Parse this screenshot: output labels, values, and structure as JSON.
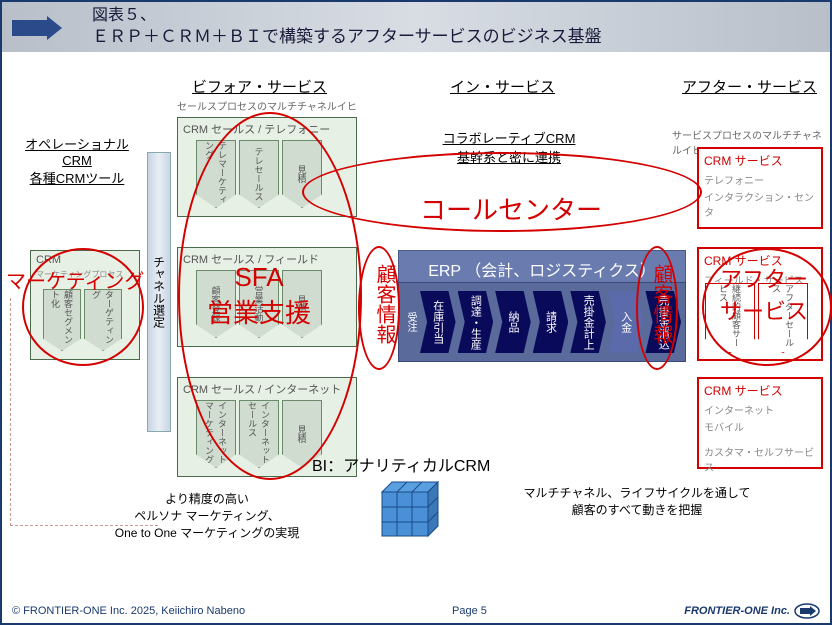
{
  "title": {
    "line1": "図表５、",
    "line2": "ＥＲＰ＋ＣＲＭ＋ＢＩで構築するアフターサービスのビジネス基盤"
  },
  "columns": {
    "before": "ビフォア・サービス",
    "before_sub": "セールスプロセスのマルチチャネルイヒ",
    "in": "イン・サービス",
    "after": "アフター・サービス",
    "after_sub": "サービスプロセスのマルチチャネルイヒ"
  },
  "left_label": {
    "l1": "オペレーショナルCRM",
    "l2": "各種CRMツール"
  },
  "collab": {
    "l1": "コラボレーティブCRM",
    "l2": "基幹系と密に連携"
  },
  "crm_marketing": {
    "title": "CRM",
    "sub": "マーケティングプロセス",
    "items": [
      "顧客セグメント化",
      "ターゲティング"
    ]
  },
  "channel": "チャネル選定",
  "crm_tel": {
    "title": "CRM セールス / テレフォニー",
    "items": [
      "テレマーケティング",
      "テレセールス",
      "見積"
    ]
  },
  "crm_field": {
    "title": "CRM セールス / フィールド",
    "items": [
      "顧客登録",
      "営業活動",
      "見積"
    ]
  },
  "crm_internet": {
    "title": "CRM セールス / インターネット",
    "items": [
      "インターネットマーケティング",
      "インターネットセールス",
      "見積"
    ]
  },
  "erp": {
    "header": "ERP （会計、ロジスティクス）",
    "intake": "受注",
    "steps": [
      "在庫引当",
      "調達・生産",
      "納品",
      "請求",
      "売掛金計上",
      "入金",
      "売掛金消込"
    ]
  },
  "crm_service1": {
    "title": "CRM サービス",
    "sub1": "テレフォニー",
    "sub2": "インタラクション・センタ"
  },
  "crm_service2": {
    "title": "CRM サービス",
    "sub1": "フィールド・サービス",
    "items": [
      "継続的顧客サービス",
      "アフターセールス"
    ]
  },
  "crm_service3": {
    "title": "CRM サービス",
    "sub1": "インターネット",
    "sub2": "モバイル",
    "sub3": "カスタマ・セルフサービス"
  },
  "red_labels": {
    "marketing": "マーケティング",
    "sfa1": "SFA",
    "sfa2": "営業支援",
    "callcenter": "コールセンター",
    "customer_info": "顧客情報",
    "after_service": "アフターサービス"
  },
  "bi_title": "BI：アナリティカルCRM",
  "bottom_left": {
    "l1": "より精度の高い",
    "l2": "ペルソナ マーケティング、",
    "l3": "One to One マーケティングの実現"
  },
  "bottom_right": {
    "l1": "マルチチャネル、ライフサイクルを通して",
    "l2": "顧客のすべて動きを把握"
  },
  "footer": {
    "copyright": "© FRONTIER-ONE Inc. 2025,  Keiichiro  Nabeno",
    "page": "Page 5",
    "brand": "FRONTIER-ONE Inc."
  }
}
